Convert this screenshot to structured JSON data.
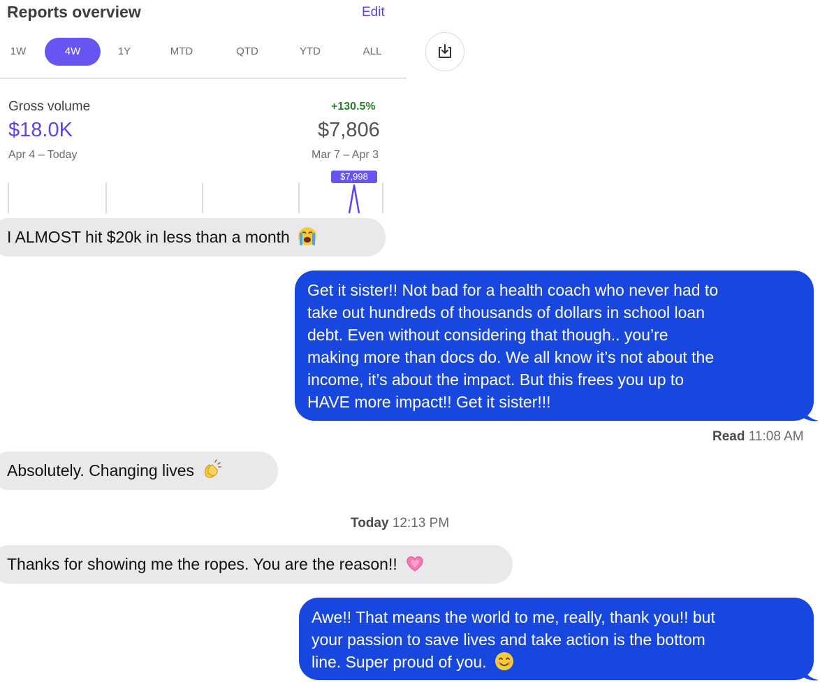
{
  "reports": {
    "title": "Reports overview",
    "edit_label": "Edit",
    "periods": [
      {
        "label": "1W",
        "active": false
      },
      {
        "label": "4W",
        "active": true
      },
      {
        "label": "1Y",
        "active": false
      },
      {
        "label": "MTD",
        "active": false
      },
      {
        "label": "QTD",
        "active": false
      },
      {
        "label": "YTD",
        "active": false
      },
      {
        "label": "ALL",
        "active": false
      }
    ],
    "download_icon": "download-icon",
    "gross_volume": {
      "label": "Gross volume",
      "change": "+130.5%",
      "current_value": "$18.0K",
      "previous_value": "$7,806",
      "current_range": "Apr 4 – Today",
      "previous_range": "Mar 7 – Apr 3",
      "tooltip_value": "$7,998"
    },
    "colors": {
      "accent": "#5a45ee",
      "positive": "#2f7d2f"
    }
  },
  "messages": [
    {
      "direction": "incoming",
      "text": "I ALMOST hit $20k in less than a month",
      "emoji": "loudly-crying-face"
    },
    {
      "direction": "outgoing",
      "lines": [
        "Get it sister!! Not bad for a health coach who never had to",
        "take out hundreds of thousands of dollars in school loan",
        "debt. Even without considering that though.. you’re",
        "making more than docs do. We all know it’s not about the",
        "income, it’s about the impact. But this frees you up to",
        "HAVE more impact!! Get it sister!!!"
      ]
    },
    {
      "direction": "incoming",
      "text": "Absolutely. Changing lives",
      "emoji": "clapping-hands"
    },
    {
      "direction": "incoming",
      "text": "Thanks for showing me the ropes. You are the reason!!",
      "emoji": "growing-heart"
    },
    {
      "direction": "outgoing",
      "lines": [
        "Awe!! That means the world to me, really, thank you!!  but",
        "your passion to save lives and take action is the bottom",
        "line. Super proud of you."
      ],
      "emoji": "smiling-face-with-smiling-eyes"
    }
  ],
  "read_receipt": {
    "label": "Read",
    "time": "11:08 AM"
  },
  "timestamp": {
    "day": "Today",
    "time": "12:13 PM"
  },
  "bubble_colors": {
    "incoming": "#e9e9eb",
    "outgoing": "#1847e0"
  }
}
